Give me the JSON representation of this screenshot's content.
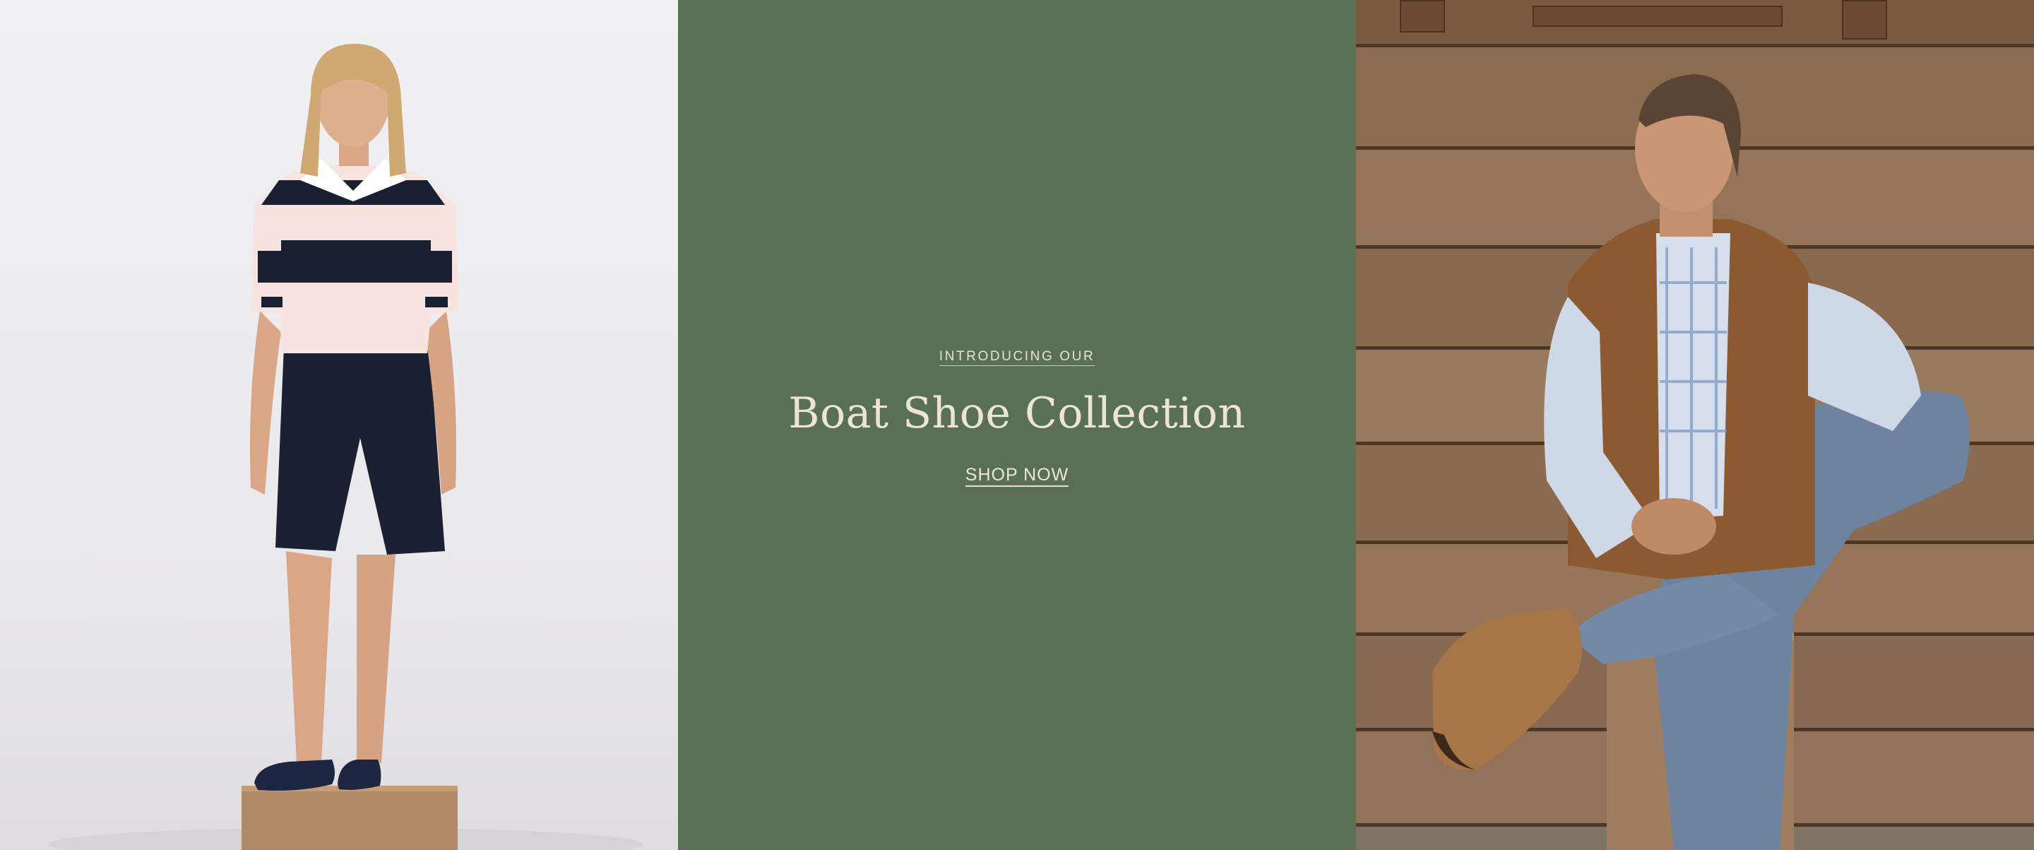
{
  "promo": {
    "eyebrow": "INTRODUCING OUR",
    "headline": "Boat Shoe Collection",
    "cta_label": "SHOP NOW"
  },
  "colors": {
    "center_panel_bg": "#5a7055",
    "text_cream": "#ece5d2",
    "left_panel_bg": "#ececef",
    "wood": "#8a6a4e"
  },
  "images": {
    "left": "woman-in-striped-rugby-shirt-denim-shorts-navy-boat-shoes",
    "right": "man-in-plaid-shirt-brown-vest-jeans-tan-boat-shoes-on-wooden-bench"
  }
}
